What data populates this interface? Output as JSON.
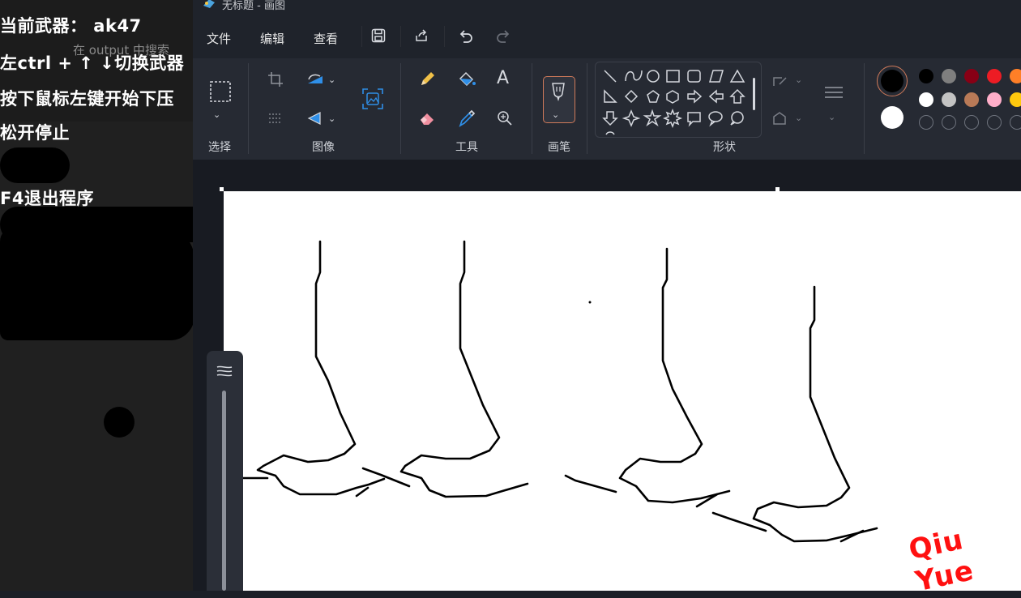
{
  "overlay": {
    "weapon_line": "当前武器： ak47",
    "switch_line": "左ctrl + ↑ ↓切换武器",
    "press_line": "按下鼠标左键开始下压",
    "release_line": "松开停止",
    "exit_line": "F4退出程序",
    "search_hint": "在 output 中搜索"
  },
  "titlebar": {
    "title": "无标题 - 画图"
  },
  "menu": {
    "file": "文件",
    "edit": "编辑",
    "view": "查看"
  },
  "ribbon": {
    "groups": {
      "select": "选择",
      "image": "图像",
      "tools": "工具",
      "brush": "画笔",
      "shapes": "形状"
    }
  },
  "colors": {
    "active_primary": "#000000",
    "active_secondary": "#ffffff",
    "palette_row1": [
      "#000000",
      "#7f7f7f",
      "#880015",
      "#ed1c24",
      "#ff7f27"
    ],
    "palette_row2": [
      "#ffffff",
      "#c3c3c3",
      "#b97a57",
      "#ffaec9",
      "#ffc90e"
    ]
  },
  "watermark": "Qiu  Yue"
}
